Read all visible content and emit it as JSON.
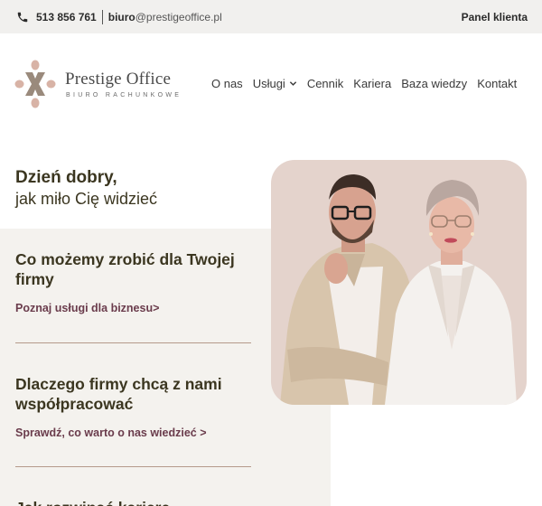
{
  "topbar": {
    "phone": "513 856 761",
    "email_bold": "biuro",
    "email_rest": "@prestigeoffice.pl",
    "panel_label": "Panel klienta"
  },
  "logo": {
    "title": "Prestige Office",
    "subtitle": "BIURO RACHUNKOWE"
  },
  "nav": {
    "items": [
      "O nas",
      "Usługi",
      "Cennik",
      "Kariera",
      "Baza wiedzy",
      "Kontakt"
    ]
  },
  "hero": {
    "greeting_bold": "Dzień dobry,",
    "greeting_light": "jak miło Cię widzieć"
  },
  "sections": [
    {
      "title": "Co możemy zrobić dla Twojej firmy",
      "link": "Poznaj usługi dla biznesu>"
    },
    {
      "title": "Dlaczego firmy chcą z nami współpracować",
      "link": "Sprawdź, co warto o nas wiedzieć >"
    },
    {
      "title": "Jak rozwinąć karierę"
    }
  ],
  "colors": {
    "accent_text": "#3b3620",
    "link": "#6a3c4c",
    "beige_bg": "#f4f2ee",
    "photo_bg": "#e4d3cc",
    "logo_pink": "#d8b3a6",
    "logo_taupe": "#9a8a7c"
  },
  "icons": {
    "phone": "phone-icon",
    "chevron": "chevron-down-icon",
    "logo": "logo-mark-icon"
  }
}
